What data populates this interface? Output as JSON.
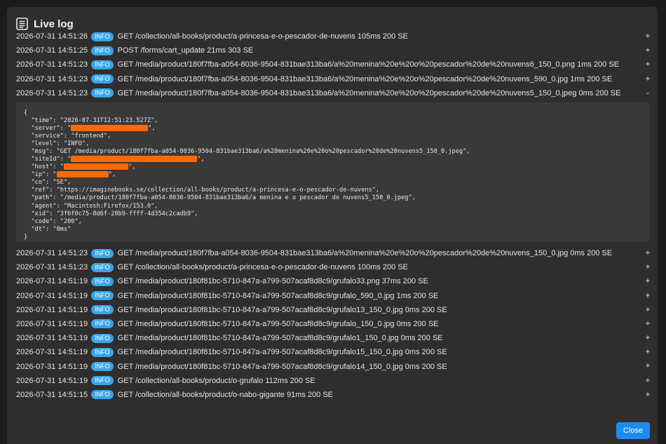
{
  "modal": {
    "title": "Live log",
    "close_label": "Close",
    "icon": "list-document-icon"
  },
  "entries_before": [
    {
      "ts": "2026-07-31 14:51:26",
      "level": "INFO",
      "msg": "GET /collection/all-books/product/a-princesa-e-o-pescador-de-nuvens  105ms 200 SE",
      "toggle": "+"
    },
    {
      "ts": "2026-07-31 14:51:25",
      "level": "INFO",
      "msg": "POST /forms/cart_update  21ms 303 SE",
      "toggle": "+"
    },
    {
      "ts": "2026-07-31 14:51:23",
      "level": "INFO",
      "msg": "GET /media/product/180f7fba-a054-8036-9504-831bae313ba6/a%20menina%20e%20o%20pescador%20de%20nuvens6_150_0.png  1ms 200 SE",
      "toggle": "+"
    },
    {
      "ts": "2026-07-31 14:51:23",
      "level": "INFO",
      "msg": "GET /media/product/180f7fba-a054-8036-9504-831bae313ba6/a%20menina%20e%20o%20pescador%20de%20nuvens_590_0.jpg  1ms 200 SE",
      "toggle": "+"
    },
    {
      "ts": "2026-07-31 14:51:23",
      "level": "INFO",
      "msg": "GET /media/product/180f7fba-a054-8036-9504-831bae313ba6/a%20menina%20e%20o%20pescador%20de%20nuvens5_150_0.jpeg  0ms 200 SE",
      "toggle": "-"
    }
  ],
  "detail_lines": [
    {
      "text": "{"
    },
    {
      "key": "time",
      "value": "\"2026-07-31T12:51:23.527Z\","
    },
    {
      "key": "server",
      "redacted": true,
      "w": 110
    },
    {
      "key": "service",
      "value": "\"frontend\","
    },
    {
      "key": "level",
      "value": "\"INFO\","
    },
    {
      "key": "msg",
      "value": "\"GET /media/product/180f7fba-a054-8036-9504-831bae313ba6/a%20menina%20e%20o%20pescador%20de%20nuvens5_150_0.jpeg\","
    },
    {
      "key": "siteId",
      "redacted": true,
      "w": 180
    },
    {
      "key": "host",
      "redacted": true,
      "w": 92
    },
    {
      "key": "ip",
      "redacted": true,
      "w": 74
    },
    {
      "key": "co",
      "value": "\"SE\","
    },
    {
      "key": "ref",
      "value": "\"https://imaginebooks.se/collection/all-books/product/a-princesa-e-o-pescador-de-nuvens\","
    },
    {
      "key": "path",
      "value": "\"/media/product/180f7fba-a054-8036-9504-831bae313ba6/a menina e o pescador de nuvens5_150_0.jpeg\","
    },
    {
      "key": "agent",
      "value": "\"Macintosh:Firefox/153.0\","
    },
    {
      "key": "xid",
      "value": "\"3f6f0c75-8d6f-28b9-ffff-4d354c2cadb9\","
    },
    {
      "key": "code",
      "value": "\"200\","
    },
    {
      "key": "dt",
      "value": "\"0ms\""
    },
    {
      "text": "}"
    }
  ],
  "entries_after": [
    {
      "ts": "2026-07-31 14:51:23",
      "level": "INFO",
      "msg": "GET /media/product/180f7fba-a054-8036-9504-831bae313ba6/a%20menina%20e%20o%20pescador%20de%20nuvens_150_0.jpg  0ms 200 SE",
      "toggle": "+"
    },
    {
      "ts": "2026-07-31 14:51:23",
      "level": "INFO",
      "msg": "GET /collection/all-books/product/a-princesa-e-o-pescador-de-nuvens  100ms 200 SE",
      "toggle": "+"
    },
    {
      "ts": "2026-07-31 14:51:19",
      "level": "INFO",
      "msg": "GET /media/product/180f81bc-5710-847a-a799-507acaf8d8c9/grufalo33.png  37ms 200 SE",
      "toggle": "+"
    },
    {
      "ts": "2026-07-31 14:51:19",
      "level": "INFO",
      "msg": "GET /media/product/180f81bc-5710-847a-a799-507acaf8d8c9/grufalo_590_0.jpg  1ms 200 SE",
      "toggle": "+"
    },
    {
      "ts": "2026-07-31 14:51:19",
      "level": "INFO",
      "msg": "GET /media/product/180f81bc-5710-847a-a799-507acaf8d8c9/grufalo13_150_0.jpg  0ms 200 SE",
      "toggle": "+"
    },
    {
      "ts": "2026-07-31 14:51:19",
      "level": "INFO",
      "msg": "GET /media/product/180f81bc-5710-847a-a799-507acaf8d8c9/grufalo_150_0.jpg  0ms 200 SE",
      "toggle": "+"
    },
    {
      "ts": "2026-07-31 14:51:19",
      "level": "INFO",
      "msg": "GET /media/product/180f81bc-5710-847a-a799-507acaf8d8c9/grufalo1_150_0.jpg  0ms 200 SE",
      "toggle": "+"
    },
    {
      "ts": "2026-07-31 14:51:19",
      "level": "INFO",
      "msg": "GET /media/product/180f81bc-5710-847a-a799-507acaf8d8c9/grufalo15_150_0.jpg  0ms 200 SE",
      "toggle": "+"
    },
    {
      "ts": "2026-07-31 14:51:19",
      "level": "INFO",
      "msg": "GET /media/product/180f81bc-5710-847a-a799-507acaf8d8c9/grufalo14_150_0.jpg  0ms 200 SE",
      "toggle": "+"
    },
    {
      "ts": "2026-07-31 14:51:19",
      "level": "INFO",
      "msg": "GET /collection/all-books/product/o-grufalo  112ms 200 SE",
      "toggle": "+"
    },
    {
      "ts": "2026-07-31 14:51:15",
      "level": "INFO",
      "msg": "GET /collection/all-books/product/o-nabo-gigante  91ms 200 SE",
      "toggle": "+"
    }
  ],
  "colors": {
    "background": "#1b1b1b",
    "modal": "#2f2d2d",
    "detail_panel": "#3a3838",
    "badge": "#3aa5e8",
    "close_button": "#1e8bf0",
    "redaction": "#ff6a00"
  }
}
